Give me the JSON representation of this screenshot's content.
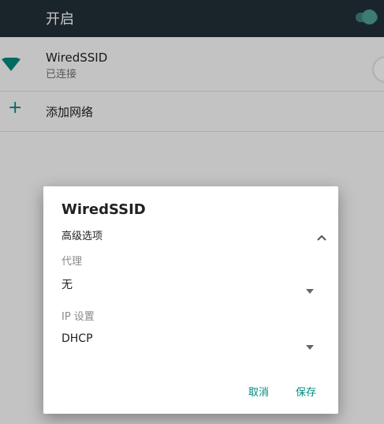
{
  "topbar": {
    "label": "开启",
    "toggle_state": "on"
  },
  "network": {
    "name": "WiredSSID",
    "status": "已连接",
    "icon": "wifi-icon"
  },
  "add_network": {
    "icon": "plus-icon",
    "label": "添加网络"
  },
  "dialog": {
    "title": "WiredSSID",
    "advanced_label": "高级选项",
    "advanced_icon": "chevron-up-icon",
    "proxy_label": "代理",
    "proxy_value": "无",
    "ip_label": "IP 设置",
    "ip_value": "DHCP",
    "cancel_label": "取消",
    "save_label": "保存"
  },
  "colors": {
    "accent": "#00897b",
    "topbar": "#223038"
  }
}
